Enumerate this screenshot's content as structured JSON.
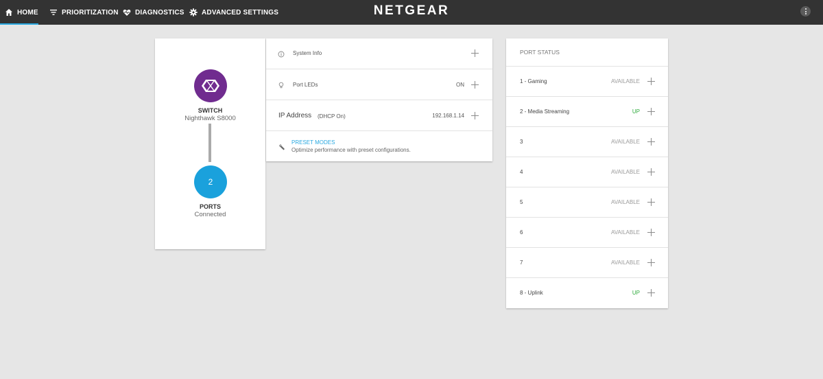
{
  "nav": {
    "home": "HOME",
    "prioritization": "PRIORITIZATION",
    "diagnostics": "DIAGNOSTICS",
    "advanced": "ADVANCED SETTINGS",
    "brand": "NETGEAR"
  },
  "device": {
    "switch_title": "SWITCH",
    "switch_model": "Nighthawk S8000",
    "ports_count": "2",
    "ports_title": "PORTS",
    "ports_status": "Connected"
  },
  "info": {
    "system_info": "System Info",
    "port_leds": "Port LEDs",
    "port_leds_value": "ON",
    "ip_label": "IP Address",
    "ip_mode": "(DHCP On)",
    "ip_value": "192.168.1.14",
    "preset_title": "PRESET MODES",
    "preset_desc": "Optimize performance with preset configurations."
  },
  "port_status": {
    "title": "PORT STATUS",
    "ports": [
      {
        "name": "1 - Gaming",
        "status": "AVAILABLE"
      },
      {
        "name": "2 - Media Streaming",
        "status": "UP"
      },
      {
        "name": "3",
        "status": "AVAILABLE"
      },
      {
        "name": "4",
        "status": "AVAILABLE"
      },
      {
        "name": "5",
        "status": "AVAILABLE"
      },
      {
        "name": "6",
        "status": "AVAILABLE"
      },
      {
        "name": "7",
        "status": "AVAILABLE"
      },
      {
        "name": "8 - Uplink",
        "status": "UP"
      }
    ]
  },
  "colors": {
    "topbar": "#333333",
    "accent_blue": "#28a8e0",
    "switch_purple": "#702c8f",
    "ports_blue": "#1aa1dc",
    "status_up": "#2eaa3c",
    "status_available": "#9a9a9a"
  },
  "icons": {
    "home": "home-icon",
    "prioritization": "filter-icon",
    "diagnostics": "heart-pulse-icon",
    "advanced": "gear-icon",
    "menu": "more-vertical-icon",
    "system_info": "info-icon",
    "port_leds": "lightbulb-icon",
    "preset": "wrench-icon"
  }
}
